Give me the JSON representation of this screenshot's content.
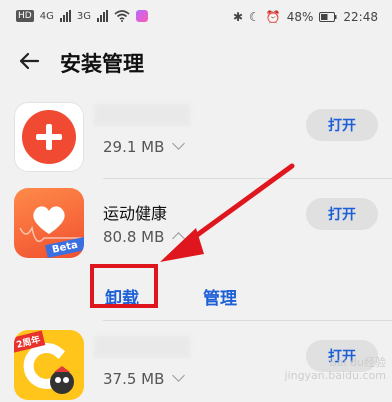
{
  "status_bar": {
    "hd": "HD",
    "net1": "4G",
    "net2": "3G",
    "battery": "48%",
    "time": "22:48"
  },
  "header": {
    "title": "安装管理"
  },
  "apps": [
    {
      "name": "",
      "size": "29.1 MB",
      "button": "打开",
      "icon": "plus-icon"
    },
    {
      "name": "运动健康",
      "size": "80.8 MB",
      "button": "打开",
      "icon": "health-heart-icon",
      "badge": "Beta",
      "actions": {
        "uninstall": "卸载",
        "manage": "管理"
      }
    },
    {
      "name": "",
      "size": "37.5 MB",
      "button": "打开",
      "icon": "game-center-icon",
      "badge": "2周年"
    }
  ],
  "watermark": {
    "line1": "Bai du经验",
    "line2": "jingyan.baidu.com"
  },
  "colors": {
    "accent": "#1c5fd6",
    "highlight": "#e0161f",
    "background": "#f1f1f1"
  }
}
